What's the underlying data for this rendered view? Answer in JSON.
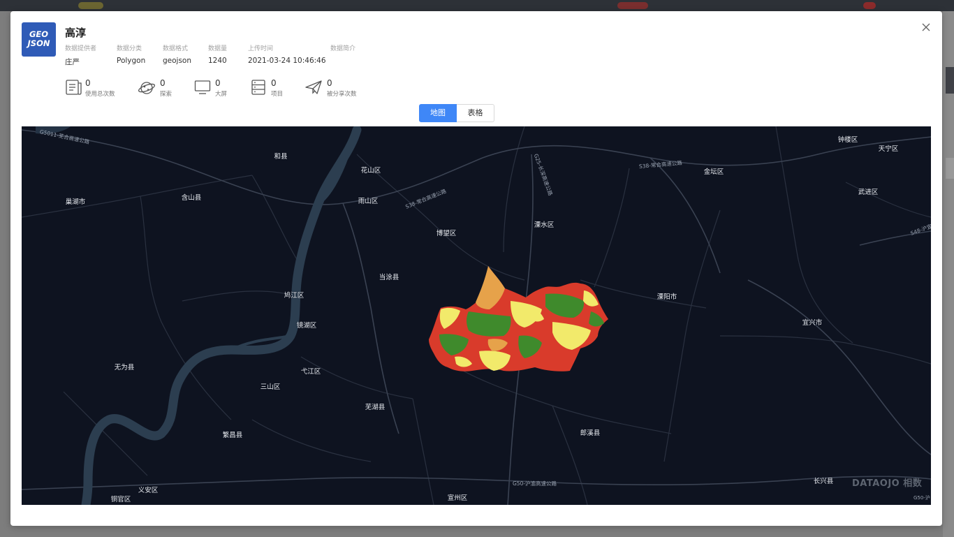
{
  "dialog": {
    "logo_line1": "GEO",
    "logo_line2": "JSON",
    "title": "高淳"
  },
  "meta": {
    "provider_label": "数据提供者",
    "provider_value": "庄严",
    "category_label": "数据分类",
    "category_value": "Polygon",
    "format_label": "数据格式",
    "format_value": "geojson",
    "count_label": "数据量",
    "count_value": "1240",
    "upload_label": "上传时间",
    "upload_value": "2021-03-24 10:46:46",
    "intro_label": "数据简介"
  },
  "stats": {
    "usage_count": "0",
    "usage_label": "使用总次数",
    "explore_count": "0",
    "explore_label": "探索",
    "screen_count": "0",
    "screen_label": "大屏",
    "project_count": "0",
    "project_label": "项目",
    "share_count": "0",
    "share_label": "被分享次数"
  },
  "tabs": {
    "map": "地图",
    "table": "表格"
  },
  "map": {
    "places": {
      "hexian": "和县",
      "huashan": "花山区",
      "zhonglou": "钟楼区",
      "tianning": "天宁区",
      "jintan": "金坛区",
      "chaohu": "巢湖市",
      "hanshan": "含山县",
      "yushan": "雨山区",
      "wujin": "武进区",
      "bowang": "博望区",
      "lishui": "溧水区",
      "dangtu": "当涂县",
      "jiujiang": "鸠江区",
      "liyang": "溧阳市",
      "jinghu": "镜湖区",
      "yixing": "宜兴市",
      "wuwei": "无为县",
      "yijiang": "弋江区",
      "sanshan": "三山区",
      "wuhu": "芜湖县",
      "fanchang": "繁昌县",
      "langxi": "郎溪县",
      "changxing": "长兴县",
      "yian": "义安区",
      "tongguan": "铜官区",
      "xuanzhou": "宣州区"
    },
    "roads": {
      "g5011": "G5011-芜合高速公路",
      "s38a": "S38-常合高速公路",
      "s38b": "S38-常合高速公路",
      "g25": "G25-长深高速公路",
      "g50": "G50-沪渝高速公路",
      "s48": "S48-沪宜",
      "g50b": "G50-沪"
    },
    "watermark": "DATAOJO 相数",
    "colors": {
      "background": "#0e1320",
      "river": "#2c3e50",
      "boundary": "#2a3140",
      "fill_red": "#d93b2b",
      "fill_yellow": "#f2ea6b",
      "fill_green": "#3f8a2c",
      "fill_orange": "#e6a24a"
    }
  }
}
